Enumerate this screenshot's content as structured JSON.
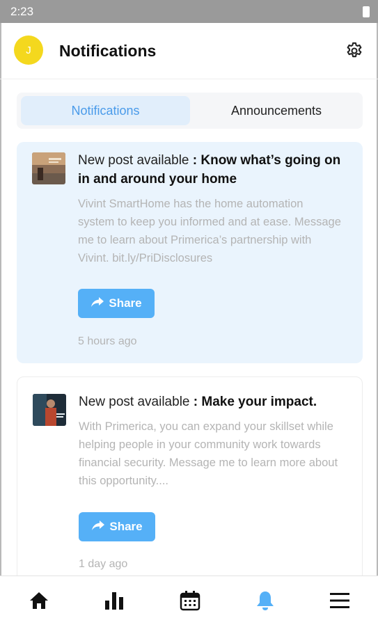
{
  "status_bar": {
    "time": "2:23"
  },
  "header": {
    "avatar_initial": "J",
    "title": "Notifications"
  },
  "tabs": [
    {
      "label": "Notifications",
      "active": true
    },
    {
      "label": "Announcements",
      "active": false
    }
  ],
  "notifications": [
    {
      "prefix": "New post available",
      "separator": " : ",
      "headline": "Know what’s going on in and around your home",
      "body": "Vivint SmartHome has the home automation system to keep you informed and at ease. Message me to learn about Primerica’s partnership with Vivint. bit.ly/PriDisclosures",
      "share_label": "Share",
      "time_ago": "5 hours ago",
      "highlighted": true
    },
    {
      "prefix": "New post available",
      "separator": " : ",
      "headline": "Make your impact.",
      "body": "With Primerica, you can expand your skillset while helping people in your community work towards financial security. Message me to learn more about this opportunity....",
      "share_label": "Share",
      "time_ago": "1 day ago",
      "highlighted": false
    }
  ],
  "bottom_nav": [
    {
      "icon": "home-icon",
      "active": false
    },
    {
      "icon": "bar-chart-icon",
      "active": false
    },
    {
      "icon": "calendar-icon",
      "active": false
    },
    {
      "icon": "bell-icon",
      "active": true
    },
    {
      "icon": "menu-icon",
      "active": false
    }
  ],
  "colors": {
    "accent": "#55b0f7",
    "active_tab_text": "#4a9bea",
    "avatar": "#f4d81e",
    "highlight_card": "#eaf4fd"
  }
}
